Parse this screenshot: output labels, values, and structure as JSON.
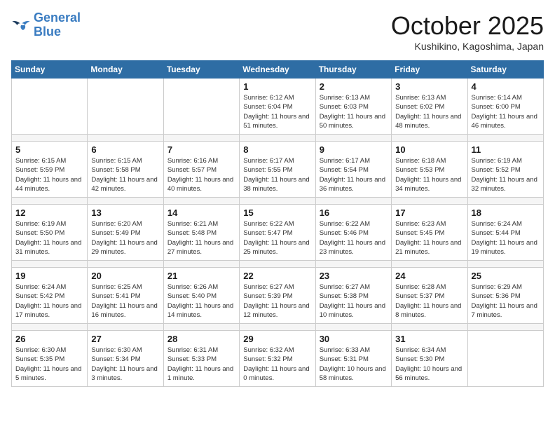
{
  "header": {
    "logo_line1": "General",
    "logo_line2": "Blue",
    "month": "October 2025",
    "location": "Kushikino, Kagoshima, Japan"
  },
  "days_of_week": [
    "Sunday",
    "Monday",
    "Tuesday",
    "Wednesday",
    "Thursday",
    "Friday",
    "Saturday"
  ],
  "weeks": [
    [
      {
        "day": "",
        "info": ""
      },
      {
        "day": "",
        "info": ""
      },
      {
        "day": "",
        "info": ""
      },
      {
        "day": "1",
        "info": "Sunrise: 6:12 AM\nSunset: 6:04 PM\nDaylight: 11 hours\nand 51 minutes."
      },
      {
        "day": "2",
        "info": "Sunrise: 6:13 AM\nSunset: 6:03 PM\nDaylight: 11 hours\nand 50 minutes."
      },
      {
        "day": "3",
        "info": "Sunrise: 6:13 AM\nSunset: 6:02 PM\nDaylight: 11 hours\nand 48 minutes."
      },
      {
        "day": "4",
        "info": "Sunrise: 6:14 AM\nSunset: 6:00 PM\nDaylight: 11 hours\nand 46 minutes."
      }
    ],
    [
      {
        "day": "5",
        "info": "Sunrise: 6:15 AM\nSunset: 5:59 PM\nDaylight: 11 hours\nand 44 minutes."
      },
      {
        "day": "6",
        "info": "Sunrise: 6:15 AM\nSunset: 5:58 PM\nDaylight: 11 hours\nand 42 minutes."
      },
      {
        "day": "7",
        "info": "Sunrise: 6:16 AM\nSunset: 5:57 PM\nDaylight: 11 hours\nand 40 minutes."
      },
      {
        "day": "8",
        "info": "Sunrise: 6:17 AM\nSunset: 5:55 PM\nDaylight: 11 hours\nand 38 minutes."
      },
      {
        "day": "9",
        "info": "Sunrise: 6:17 AM\nSunset: 5:54 PM\nDaylight: 11 hours\nand 36 minutes."
      },
      {
        "day": "10",
        "info": "Sunrise: 6:18 AM\nSunset: 5:53 PM\nDaylight: 11 hours\nand 34 minutes."
      },
      {
        "day": "11",
        "info": "Sunrise: 6:19 AM\nSunset: 5:52 PM\nDaylight: 11 hours\nand 32 minutes."
      }
    ],
    [
      {
        "day": "12",
        "info": "Sunrise: 6:19 AM\nSunset: 5:50 PM\nDaylight: 11 hours\nand 31 minutes."
      },
      {
        "day": "13",
        "info": "Sunrise: 6:20 AM\nSunset: 5:49 PM\nDaylight: 11 hours\nand 29 minutes."
      },
      {
        "day": "14",
        "info": "Sunrise: 6:21 AM\nSunset: 5:48 PM\nDaylight: 11 hours\nand 27 minutes."
      },
      {
        "day": "15",
        "info": "Sunrise: 6:22 AM\nSunset: 5:47 PM\nDaylight: 11 hours\nand 25 minutes."
      },
      {
        "day": "16",
        "info": "Sunrise: 6:22 AM\nSunset: 5:46 PM\nDaylight: 11 hours\nand 23 minutes."
      },
      {
        "day": "17",
        "info": "Sunrise: 6:23 AM\nSunset: 5:45 PM\nDaylight: 11 hours\nand 21 minutes."
      },
      {
        "day": "18",
        "info": "Sunrise: 6:24 AM\nSunset: 5:44 PM\nDaylight: 11 hours\nand 19 minutes."
      }
    ],
    [
      {
        "day": "19",
        "info": "Sunrise: 6:24 AM\nSunset: 5:42 PM\nDaylight: 11 hours\nand 17 minutes."
      },
      {
        "day": "20",
        "info": "Sunrise: 6:25 AM\nSunset: 5:41 PM\nDaylight: 11 hours\nand 16 minutes."
      },
      {
        "day": "21",
        "info": "Sunrise: 6:26 AM\nSunset: 5:40 PM\nDaylight: 11 hours\nand 14 minutes."
      },
      {
        "day": "22",
        "info": "Sunrise: 6:27 AM\nSunset: 5:39 PM\nDaylight: 11 hours\nand 12 minutes."
      },
      {
        "day": "23",
        "info": "Sunrise: 6:27 AM\nSunset: 5:38 PM\nDaylight: 11 hours\nand 10 minutes."
      },
      {
        "day": "24",
        "info": "Sunrise: 6:28 AM\nSunset: 5:37 PM\nDaylight: 11 hours\nand 8 minutes."
      },
      {
        "day": "25",
        "info": "Sunrise: 6:29 AM\nSunset: 5:36 PM\nDaylight: 11 hours\nand 7 minutes."
      }
    ],
    [
      {
        "day": "26",
        "info": "Sunrise: 6:30 AM\nSunset: 5:35 PM\nDaylight: 11 hours\nand 5 minutes."
      },
      {
        "day": "27",
        "info": "Sunrise: 6:30 AM\nSunset: 5:34 PM\nDaylight: 11 hours\nand 3 minutes."
      },
      {
        "day": "28",
        "info": "Sunrise: 6:31 AM\nSunset: 5:33 PM\nDaylight: 11 hours\nand 1 minute."
      },
      {
        "day": "29",
        "info": "Sunrise: 6:32 AM\nSunset: 5:32 PM\nDaylight: 11 hours\nand 0 minutes."
      },
      {
        "day": "30",
        "info": "Sunrise: 6:33 AM\nSunset: 5:31 PM\nDaylight: 10 hours\nand 58 minutes."
      },
      {
        "day": "31",
        "info": "Sunrise: 6:34 AM\nSunset: 5:30 PM\nDaylight: 10 hours\nand 56 minutes."
      },
      {
        "day": "",
        "info": ""
      }
    ]
  ]
}
